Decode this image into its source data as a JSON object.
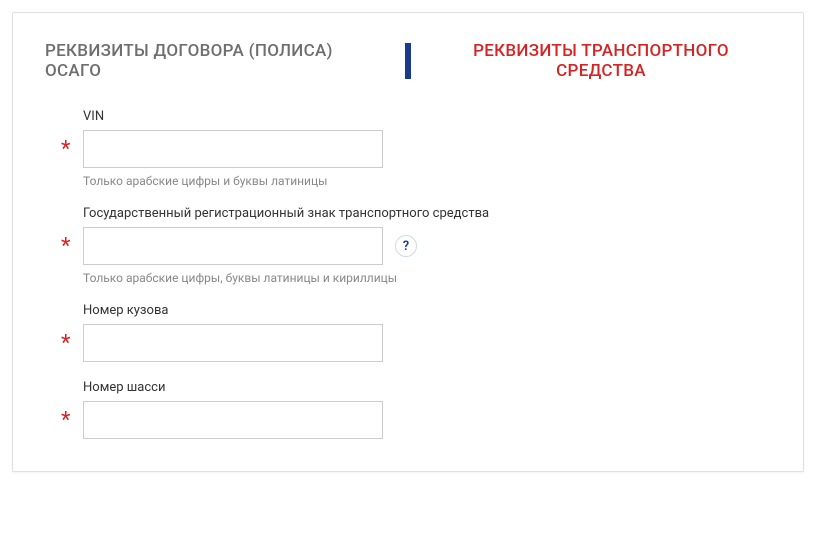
{
  "tabs": {
    "left": "РЕКВИЗИТЫ ДОГОВОРА (ПОЛИСА) ОСАГО",
    "right": "РЕКВИЗИТЫ ТРАНСПОРТНОГО СРЕДСТВА"
  },
  "fields": {
    "vin": {
      "label": "VIN",
      "value": "",
      "hint": "Только арабские цифры и буквы латиницы",
      "required": "*"
    },
    "regplate": {
      "label": "Государственный регистрационный знак транспортного средства",
      "value": "",
      "hint": "Только арабские цифры, буквы латиницы и кириллицы",
      "required": "*",
      "help": "?"
    },
    "body": {
      "label": "Номер кузова",
      "value": "",
      "required": "*"
    },
    "chassis": {
      "label": "Номер шасси",
      "value": "",
      "required": "*"
    }
  }
}
